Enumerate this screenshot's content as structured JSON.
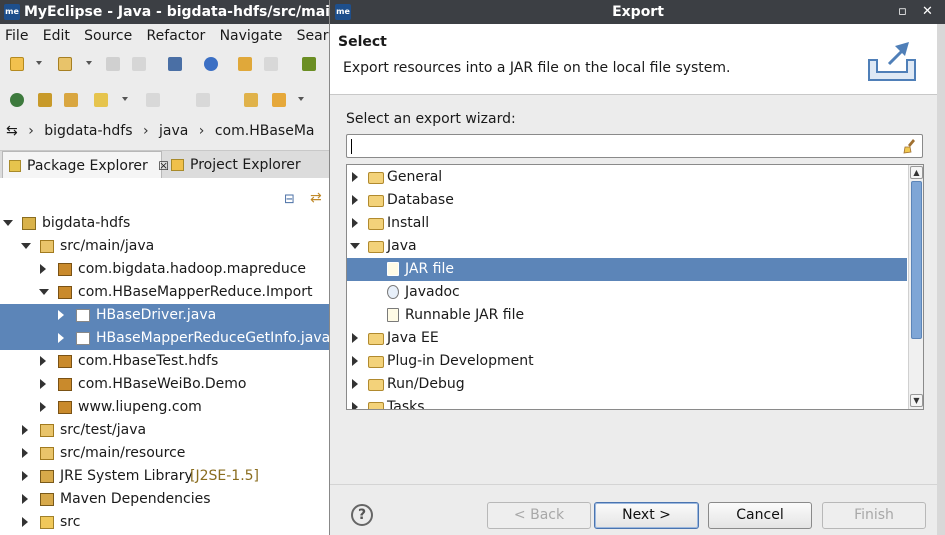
{
  "ide": {
    "window_title": "MyEclipse - Java - bigdata-hdfs/src/main",
    "app_badge": "me",
    "menu": [
      "File",
      "Edit",
      "Source",
      "Refactor",
      "Navigate",
      "Search"
    ],
    "breadcrumb": [
      "bigdata-hdfs",
      "java",
      "com.HBaseMa"
    ],
    "tabs": {
      "package_explorer": "Package Explorer",
      "project_explorer": "Project Explorer"
    },
    "tree": [
      {
        "label": "bigdata-hdfs",
        "level": 0,
        "state": "expanded",
        "icon": "project-icon"
      },
      {
        "label": "src/main/java",
        "level": 1,
        "state": "expanded",
        "icon": "source-folder-icon"
      },
      {
        "label": "com.bigdata.hadoop.mapreduce",
        "level": 2,
        "state": "collapsed",
        "icon": "package-icon"
      },
      {
        "label": "com.HBaseMapperReduce.Import",
        "level": 2,
        "state": "expanded",
        "icon": "package-icon"
      },
      {
        "label": "HBaseDriver.java",
        "level": 3,
        "state": "collapsed",
        "icon": "java-file-icon",
        "selected": true
      },
      {
        "label": "HBaseMapperReduceGetInfo.java",
        "level": 3,
        "state": "collapsed",
        "icon": "java-file-icon",
        "selected": true
      },
      {
        "label": "com.HbaseTest.hdfs",
        "level": 2,
        "state": "collapsed",
        "icon": "package-icon"
      },
      {
        "label": "com.HBaseWeiBo.Demo",
        "level": 2,
        "state": "collapsed",
        "icon": "package-icon"
      },
      {
        "label": "www.liupeng.com",
        "level": 2,
        "state": "collapsed",
        "icon": "package-icon"
      },
      {
        "label": "src/test/java",
        "level": 1,
        "state": "collapsed",
        "icon": "source-folder-icon"
      },
      {
        "label": "src/main/resource",
        "level": 1,
        "state": "collapsed",
        "icon": "source-folder-icon"
      },
      {
        "label": "JRE System Library",
        "suffix": "[J2SE-1.5]",
        "level": 1,
        "state": "collapsed",
        "icon": "library-icon"
      },
      {
        "label": "Maven Dependencies",
        "level": 1,
        "state": "collapsed",
        "icon": "library-icon"
      },
      {
        "label": "src",
        "level": 1,
        "state": "collapsed",
        "icon": "folder-icon"
      }
    ]
  },
  "dialog": {
    "title": "Export",
    "header_title": "Select",
    "header_desc": "Export resources into a JAR file on the local file system.",
    "wizard_label": "Select an export wizard:",
    "filter_value": "",
    "wizards": [
      {
        "label": "General",
        "level": 0,
        "state": "collapsed",
        "icon": "folder-icon"
      },
      {
        "label": "Database",
        "level": 0,
        "state": "collapsed",
        "icon": "folder-icon"
      },
      {
        "label": "Install",
        "level": 0,
        "state": "collapsed",
        "icon": "folder-icon"
      },
      {
        "label": "Java",
        "level": 0,
        "state": "expanded",
        "icon": "folder-icon"
      },
      {
        "label": "JAR file",
        "level": 1,
        "state": "leaf",
        "icon": "jar-icon",
        "selected": true
      },
      {
        "label": "Javadoc",
        "level": 1,
        "state": "leaf",
        "icon": "javadoc-icon"
      },
      {
        "label": "Runnable JAR file",
        "level": 1,
        "state": "leaf",
        "icon": "runnable-jar-icon"
      },
      {
        "label": "Java EE",
        "level": 0,
        "state": "collapsed",
        "icon": "folder-icon"
      },
      {
        "label": "Plug-in Development",
        "level": 0,
        "state": "collapsed",
        "icon": "folder-icon"
      },
      {
        "label": "Run/Debug",
        "level": 0,
        "state": "collapsed",
        "icon": "folder-icon"
      },
      {
        "label": "Tasks",
        "level": 0,
        "state": "collapsed",
        "icon": "folder-icon"
      }
    ],
    "buttons": {
      "back": "< Back",
      "next": "Next >",
      "cancel": "Cancel",
      "finish": "Finish",
      "help": "?"
    }
  },
  "colors": {
    "selection": "#5c85b8",
    "titlebar": "#3c3f44",
    "scroll_thumb": "#7fa6d6"
  }
}
